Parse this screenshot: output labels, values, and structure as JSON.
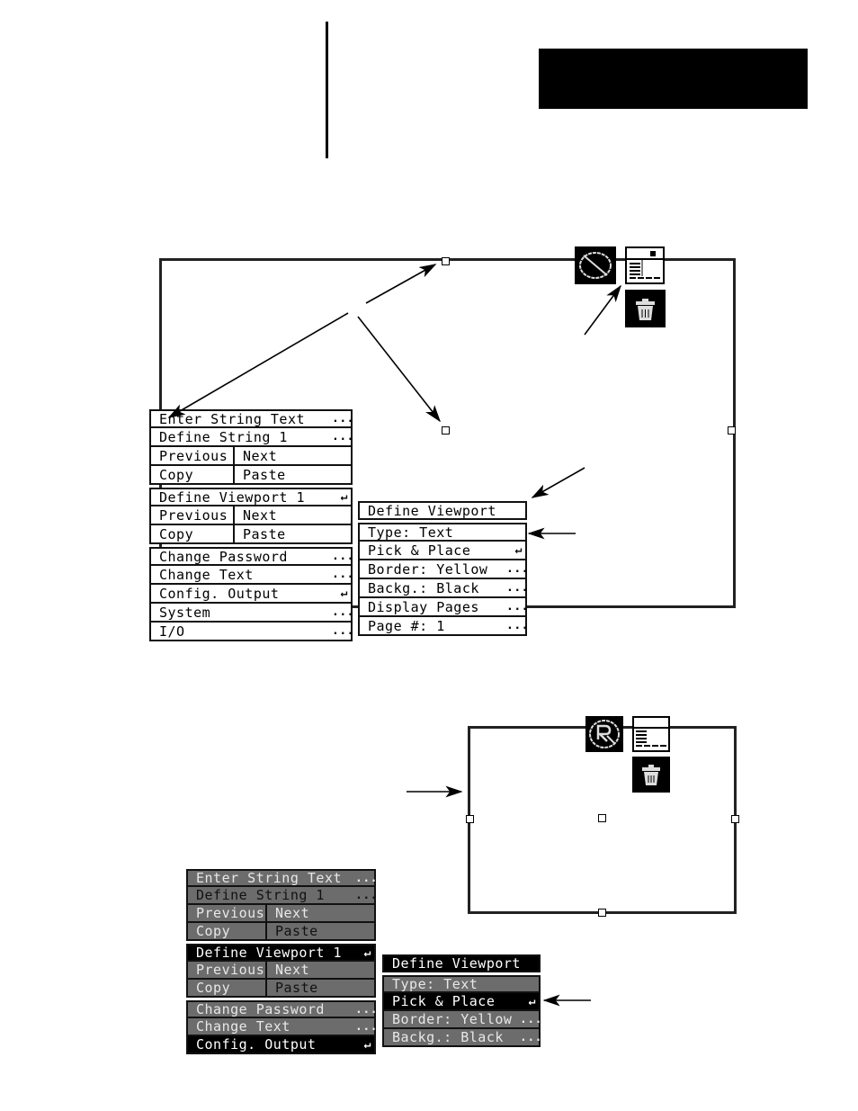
{
  "top_menu": {
    "group1": [
      {
        "label": "Enter String Text",
        "suffix": "..."
      },
      {
        "label": "Define String 1",
        "suffix": "..."
      },
      {
        "split": [
          "Previous",
          "Next"
        ]
      },
      {
        "split": [
          "Copy",
          "Paste"
        ]
      }
    ],
    "group2": [
      {
        "label": "Define Viewport 1",
        "suffix": "↵"
      },
      {
        "split": [
          "Previous",
          "Next"
        ]
      },
      {
        "split": [
          "Copy",
          "Paste"
        ]
      }
    ],
    "group3": [
      {
        "label": "Change Password",
        "suffix": "..."
      },
      {
        "label": "Change Text",
        "suffix": "..."
      },
      {
        "label": "Config. Output",
        "suffix": "↵"
      },
      {
        "label": "System",
        "suffix": "..."
      },
      {
        "label": "I/O",
        "suffix": "..."
      }
    ]
  },
  "top_submenu": {
    "header": "Define Viewport",
    "items": [
      {
        "label": "Type: Text",
        "suffix": ""
      },
      {
        "label": "Pick & Place",
        "suffix": "↵"
      },
      {
        "label": "Border: Yellow",
        "suffix": "..."
      },
      {
        "label": "Backg.: Black",
        "suffix": "..."
      },
      {
        "label": "Display Pages",
        "suffix": "..."
      },
      {
        "label": "Page #: 1",
        "suffix": "..."
      }
    ]
  },
  "bottom_menu": {
    "group1": [
      {
        "label": "Enter String Text",
        "suffix": "..."
      },
      {
        "label": "Define String 1",
        "suffix": "..."
      },
      {
        "split": [
          "Previous",
          "Next"
        ]
      },
      {
        "split": [
          "Copy",
          "Paste"
        ]
      }
    ],
    "group2": [
      {
        "label": "Define Viewport 1",
        "suffix": "↵",
        "selected": true
      },
      {
        "split": [
          "Previous",
          "Next"
        ]
      },
      {
        "split": [
          "Copy",
          "Paste"
        ]
      }
    ],
    "group3": [
      {
        "label": "Change Password",
        "suffix": "..."
      },
      {
        "label": "Change Text",
        "suffix": "..."
      },
      {
        "label": "Config. Output",
        "suffix": "↵",
        "selected": true
      }
    ]
  },
  "bottom_submenu": {
    "header": "Define Viewport",
    "items": [
      {
        "label": "Type: Text",
        "suffix": ""
      },
      {
        "label": "Pick & Place",
        "suffix": "↵",
        "selected": true
      },
      {
        "label": "Border: Yellow",
        "suffix": "..."
      },
      {
        "label": "Backg.: Black",
        "suffix": "..."
      }
    ]
  },
  "icons": {
    "top": [
      "no-draw-icon",
      "screen-layout-icon",
      "trash-icon"
    ],
    "bottom": [
      "pick-place-cursor-icon",
      "screen-layout-icon",
      "trash-icon"
    ]
  },
  "colors": {
    "menu_dim": "#6c6c6c",
    "menu_selected": "#000000",
    "menu_text_light": "#e8e8e8"
  }
}
